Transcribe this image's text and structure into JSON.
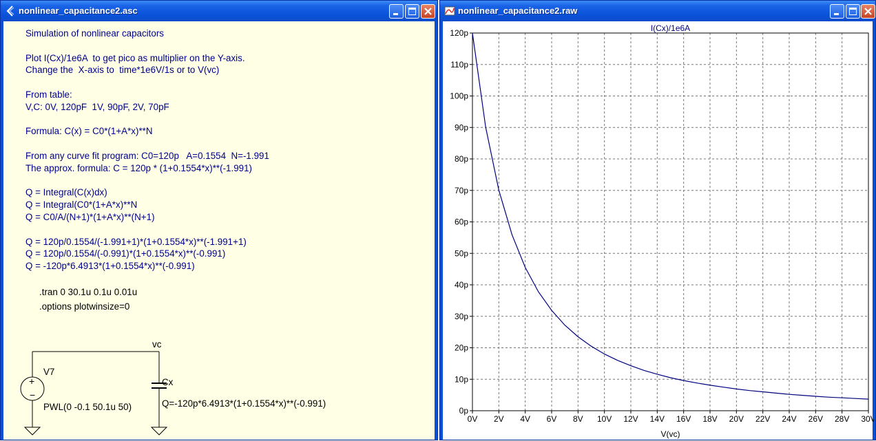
{
  "schematic": {
    "title": "nonlinear_capacitance2.asc",
    "note_lines": [
      "Simulation of nonlinear capacitors",
      "",
      "Plot I(Cx)/1e6A  to get pico as multiplier on the Y-axis.",
      "Change the  X-axis to  time*1e6V/1s or to V(vc)",
      "",
      "From table:",
      "V,C: 0V, 120pF  1V, 90pF, 2V, 70pF",
      "",
      "Formula: C(x) = C0*(1+A*x)**N",
      "",
      "From any curve fit program: C0=120p   A=0.1554  N=-1.991",
      "The approx. formula: C = 120p * (1+0.1554*x)**(-1.991)",
      "",
      "Q = Integral(C(x)dx)",
      "Q = Integral(C0*(1+A*x)**N",
      "Q = C0/A/(N+1)*(1+A*x)**(N+1)",
      "",
      "Q = 120p/0.1554/(-1.991+1)*(1+0.1554*x)**(-1.991+1)",
      "Q = 120p/0.1554/(-0.991)*(1+0.1554*x)**(-0.991)",
      "Q = -120p*6.4913*(1+0.1554*x)**(-0.991)"
    ],
    "directives": [
      ".tran 0 30.1u 0.1u 0.01u",
      ".options plotwinsize=0"
    ],
    "net_label": "vc",
    "source_name": "V7",
    "source_value": "PWL(0 -0.1 50.1u 50)",
    "cap_name": "Cx",
    "cap_value": "Q=-120p*6.4913*(1+0.1554*x)**(-0.991)"
  },
  "waveform": {
    "title": "nonlinear_capacitance2.raw",
    "trace_label": "I(Cx)/1e6A",
    "x_axis_label": "V(vc)",
    "trace_color": "#00007f",
    "chart_data": {
      "type": "line",
      "title": "I(Cx)/1e6A",
      "xlabel": "V(vc)",
      "ylabel": "",
      "xlim": [
        0,
        30
      ],
      "ylim": [
        0,
        120
      ],
      "grid": true,
      "x_ticks": [
        "0V",
        "2V",
        "4V",
        "6V",
        "8V",
        "10V",
        "12V",
        "14V",
        "16V",
        "18V",
        "20V",
        "22V",
        "24V",
        "26V",
        "28V",
        "30V"
      ],
      "y_ticks": [
        "0p",
        "10p",
        "20p",
        "30p",
        "40p",
        "50p",
        "60p",
        "70p",
        "80p",
        "90p",
        "100p",
        "110p",
        "120p"
      ],
      "series": [
        {
          "x": [
            0,
            1,
            2,
            3,
            4,
            5,
            6,
            7,
            8,
            9,
            10,
            11,
            12,
            13,
            14,
            15,
            16,
            17,
            18,
            19,
            20,
            21,
            22,
            23,
            24,
            25,
            26,
            27,
            28,
            29,
            30
          ],
          "values": [
            120,
            90.1,
            70.1,
            55.9,
            45.5,
            37.8,
            31.9,
            27.2,
            23.5,
            20.5,
            18.0,
            16.0,
            14.3,
            12.8,
            11.6,
            10.5,
            9.6,
            8.8,
            8.1,
            7.5,
            6.9,
            6.4,
            6.0,
            5.6,
            5.2,
            4.9,
            4.6,
            4.3,
            4.1,
            3.9,
            3.7
          ]
        }
      ]
    }
  }
}
